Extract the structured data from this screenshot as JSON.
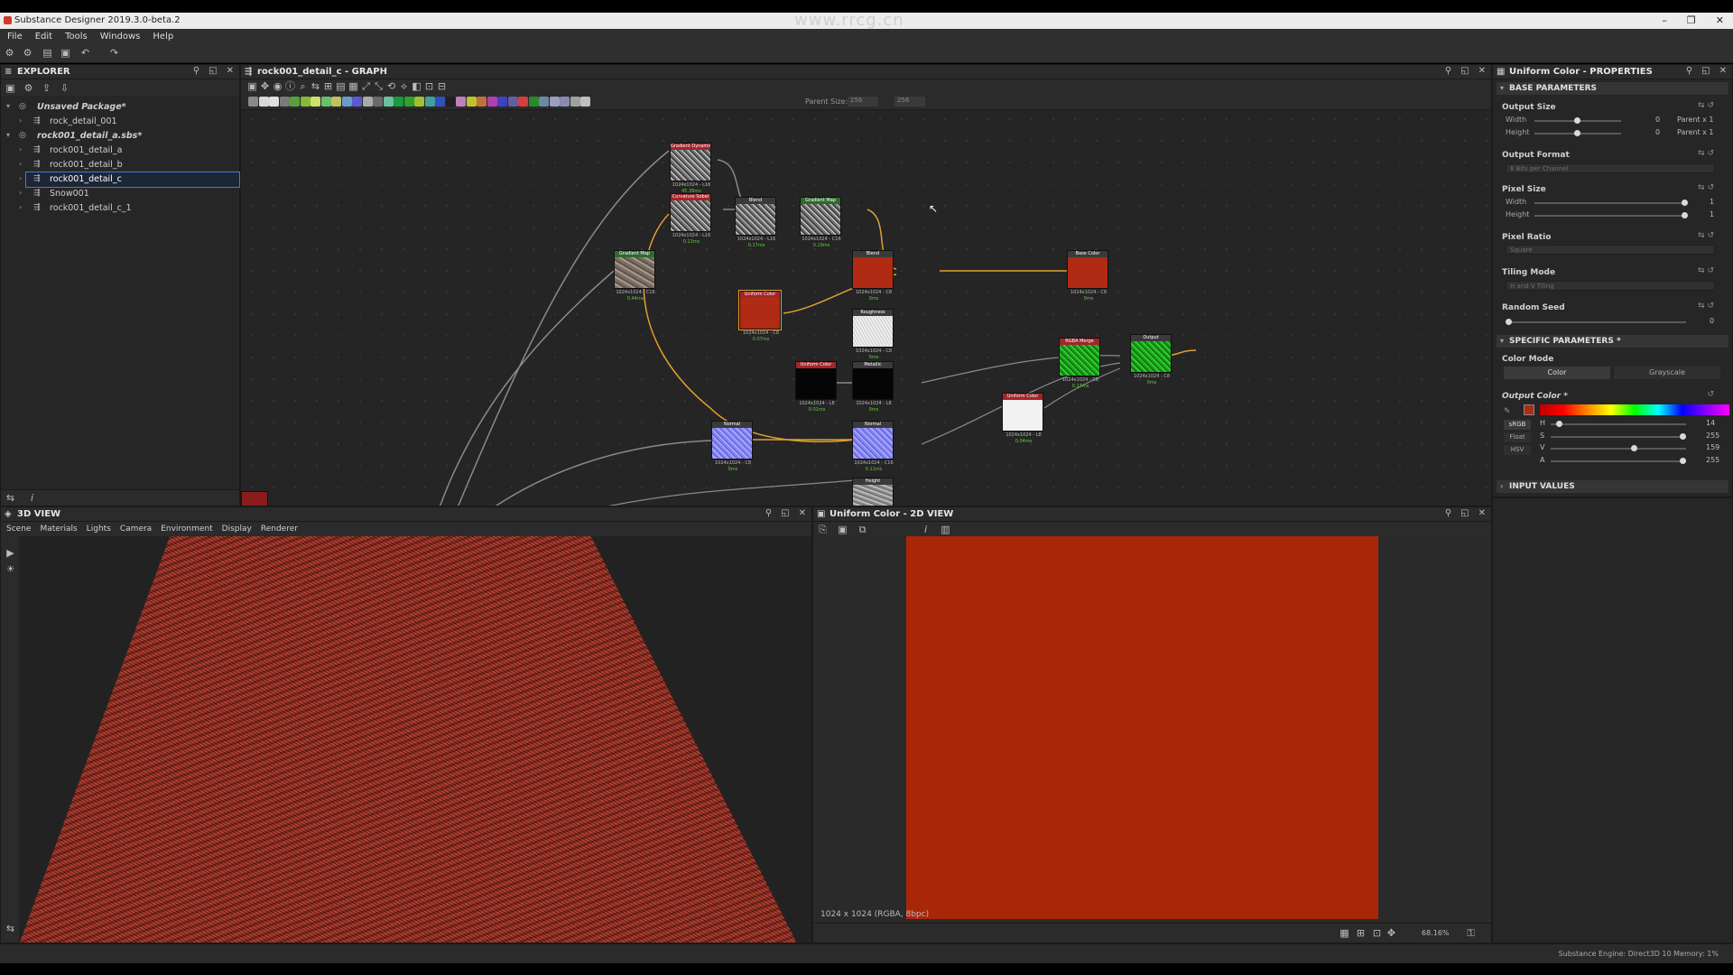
{
  "window": {
    "title": "Substance Designer 2019.3.0-beta.2",
    "controls": [
      "–",
      "❐",
      "✕"
    ]
  },
  "watermark": {
    "top_text": "www.rrcg.cn"
  },
  "menu": [
    "File",
    "Edit",
    "Tools",
    "Windows",
    "Help"
  ],
  "explorer": {
    "title": "EXPLORER",
    "items": [
      {
        "label": "Unsaved Package*",
        "kind": "package",
        "expanded": true
      },
      {
        "label": "rock_detail_001",
        "kind": "graph",
        "level": 1
      },
      {
        "label": "rock001_detail_a.sbs*",
        "kind": "package",
        "expanded": true
      },
      {
        "label": "rock001_detail_a",
        "kind": "graph",
        "level": 1
      },
      {
        "label": "rock001_detail_b",
        "kind": "graph",
        "level": 1
      },
      {
        "label": "rock001_detail_c",
        "kind": "graph",
        "level": 1,
        "selected": true
      },
      {
        "label": "Snow001",
        "kind": "graph",
        "level": 1
      },
      {
        "label": "rock001_detail_c_1",
        "kind": "graph",
        "level": 1
      }
    ]
  },
  "graph": {
    "title": "rock001_detail_c - GRAPH",
    "parent_size_label": "Parent Size:",
    "parent_size_value": "256",
    "nodes": [
      {
        "id": "n1",
        "title": "Gradient Dynamic (Gra...",
        "format": "1024x1024 - L16",
        "time": "45.38ms",
        "tex": "noise",
        "head": "#a0262a"
      },
      {
        "id": "n2",
        "title": "Curvature Sobel",
        "format": "1024x1024 - L16",
        "time": "0.13ms",
        "tex": "noise",
        "head": "#a0262a"
      },
      {
        "id": "n3",
        "title": "Blend",
        "format": "1024x1024 - L16",
        "time": "0.17ms",
        "tex": "noise",
        "head": "#3a3a3a"
      },
      {
        "id": "n4",
        "title": "Gradient Map",
        "format": "1024x1024 - C16",
        "time": "0.19ms",
        "tex": "noise",
        "head": "#2e6a2e"
      },
      {
        "id": "n5",
        "title": "Gradient Map",
        "format": "1024x1024 - C16",
        "time": "0.44ms",
        "tex": "stone",
        "head": "#2e6a2e"
      },
      {
        "id": "n6",
        "title": "Uniform Color",
        "format": "1024x1024 - C8",
        "time": "0.07ms",
        "tex": "red",
        "head": "#a0262a"
      },
      {
        "id": "n7",
        "title": "Blend",
        "format": "1024x1024 - C8",
        "time": "0ms",
        "tex": "red",
        "head": "#3a3a3a"
      },
      {
        "id": "n8",
        "title": "Base Color",
        "format": "1024x1024 - C8",
        "time": "0ms",
        "tex": "red",
        "head": "#3a3a3a"
      },
      {
        "id": "n9",
        "title": "Roughness",
        "format": "1024x1024 - C8",
        "time": "0ms",
        "tex": "white",
        "head": "#3a3a3a"
      },
      {
        "id": "n10",
        "title": "Uniform Color",
        "format": "1024x1024 - L8",
        "time": "0.01ms",
        "tex": "black",
        "head": "#a0262a"
      },
      {
        "id": "n11",
        "title": "Metallic",
        "format": "1024x1024 - L8",
        "time": "0ms",
        "tex": "black",
        "head": "#3a3a3a"
      },
      {
        "id": "n12",
        "title": "Normal",
        "format": "1024x1024 - C8",
        "time": "0ms",
        "tex": "blue",
        "head": "#3a3a3a"
      },
      {
        "id": "n13",
        "title": "Normal",
        "format": "1024x1024 - C16",
        "time": "0.11ms",
        "tex": "blue",
        "head": "#3a3a3a"
      },
      {
        "id": "n14",
        "title": "RGBA Merge",
        "format": "1024x1024 - C8",
        "time": "0.17ms",
        "tex": "green",
        "head": "#a0262a"
      },
      {
        "id": "n15",
        "title": "Output",
        "format": "1024x1024 - C8",
        "time": "0ms",
        "tex": "green",
        "head": "#3a3a3a"
      },
      {
        "id": "n16",
        "title": "Uniform Color",
        "format": "1024x1024 - L8",
        "time": "0.04ms",
        "tex": "whiteflat",
        "head": "#a0262a"
      },
      {
        "id": "n17",
        "title": "Height",
        "format": "",
        "time": "",
        "tex": "grayrock",
        "head": "#3a3a3a"
      }
    ]
  },
  "properties": {
    "title": "Uniform Color - PROPERTIES",
    "base_section": "BASE PARAMETERS",
    "output_size": {
      "label": "Output Size",
      "width_label": "Width",
      "height_label": "Height",
      "width_val": "0",
      "height_val": "0",
      "width_rel": "Parent x 1",
      "height_rel": "Parent x 1"
    },
    "output_format": {
      "label": "Output Format",
      "value": "8 Bits per Channel"
    },
    "pixel_size": {
      "label": "Pixel Size",
      "width_label": "Width",
      "height_label": "Height",
      "width_val": "1",
      "height_val": "1"
    },
    "pixel_ratio": {
      "label": "Pixel Ratio",
      "value": "Square"
    },
    "tiling_mode": {
      "label": "Tiling Mode",
      "value": "H and V Tiling"
    },
    "random_seed": {
      "label": "Random Seed",
      "value": "0"
    },
    "specific_section": "SPECIFIC PARAMETERS *",
    "color_mode": {
      "label": "Color Mode",
      "options": [
        "Color",
        "Grayscale"
      ],
      "selected": "Color"
    },
    "output_color": {
      "label": "Output Color *",
      "swatch": "#b02a14",
      "space_buttons": [
        "sRGB",
        "Float",
        "HSV"
      ],
      "channels": [
        {
          "name": "H",
          "value": "14",
          "level": 0.04
        },
        {
          "name": "S",
          "value": "255",
          "level": 1.0
        },
        {
          "name": "V",
          "value": "159",
          "level": 0.62
        },
        {
          "name": "A",
          "value": "255",
          "level": 1.0
        }
      ]
    },
    "input_section": "INPUT VALUES"
  },
  "view3d": {
    "title": "3D VIEW",
    "tabs": [
      "Scene",
      "Materials",
      "Lights",
      "Camera",
      "Environment",
      "Display",
      "Renderer"
    ]
  },
  "view2d": {
    "title": "Uniform Color - 2D VIEW",
    "image_color": "#a92608",
    "info": "1024 x 1024 (RGBA, 8bpc)",
    "zoom": "68.16%"
  },
  "status": {
    "engine": "Substance Engine: Direct3D 10  Memory: 1%"
  },
  "colors": {
    "accent": "#3d7bd6",
    "link": "#e0a030",
    "panel": "#262626"
  }
}
